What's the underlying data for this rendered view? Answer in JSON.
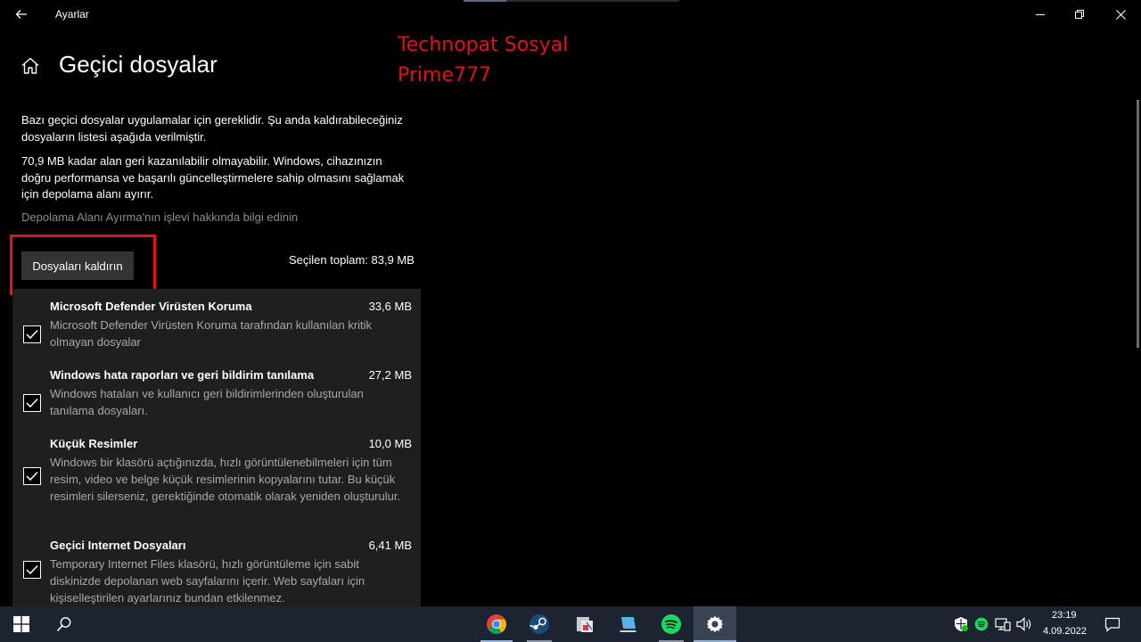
{
  "window": {
    "title": "Ayarlar"
  },
  "page": {
    "title": "Geçici dosyalar",
    "description1": "Bazı geçici dosyalar uygulamalar için gereklidir. Şu anda kaldırabileceğiniz dosyaların listesi aşağıda verilmiştir.",
    "description2": "70,9 MB kadar alan geri kazanılabilir olmayabilir. Windows, cihazınızın doğru performansa ve başarılı güncelleştirmelere sahip olmasını sağlamak için depolama alanı ayırır.",
    "link": "Depolama Alanı Ayırma'nın işlevi hakkında bilgi edinin",
    "remove_button": "Dosyaları kaldırın",
    "selected_total": "Seçilen toplam: 83,9 MB"
  },
  "watermark": {
    "line1": "Technopat Sosyal",
    "line2": "Prime777"
  },
  "items": [
    {
      "name": "Microsoft Defender Virüsten Koruma",
      "size": "33,6 MB",
      "description": "Microsoft Defender Virüsten Koruma tarafından kullanılan kritik olmayan dosyalar",
      "checked": true
    },
    {
      "name": "Windows hata raporları ve geri bildirim tanılama",
      "size": "27,2 MB",
      "description": "Windows hataları ve kullanıcı geri bildirimlerinden oluşturulan tanılama dosyaları.",
      "checked": true
    },
    {
      "name": "Küçük Resimler",
      "size": "10,0 MB",
      "description": "Windows bir klasörü açtığınızda, hızlı görüntülenebilmeleri için tüm resim, video ve belge küçük resimlerinin kopyalarını tutar. Bu küçük resimleri silerseniz, gerektiğinde otomatik olarak yeniden oluşturulur.",
      "checked": true
    },
    {
      "name": "Geçici Internet Dosyaları",
      "size": "6,41 MB",
      "description": "Temporary Internet Files klasörü, hızlı görüntüleme için sabit diskinizde depolanan web sayfalarını içerir. Web sayfaları için kişiselleştirilen ayarlarınız bundan etkilenmez.",
      "checked": true
    }
  ],
  "taskbar": {
    "time": "23:19",
    "date": "4.09.2022",
    "apps": [
      "chrome-icon",
      "steam-icon",
      "image-app-icon",
      "pc-app-icon",
      "spotify-icon",
      "settings-icon"
    ]
  },
  "colors": {
    "watermark": "#e1101e",
    "highlight_box": "#e0141e",
    "taskbar": "#1b2430",
    "list_background": "#1f1f1f"
  }
}
